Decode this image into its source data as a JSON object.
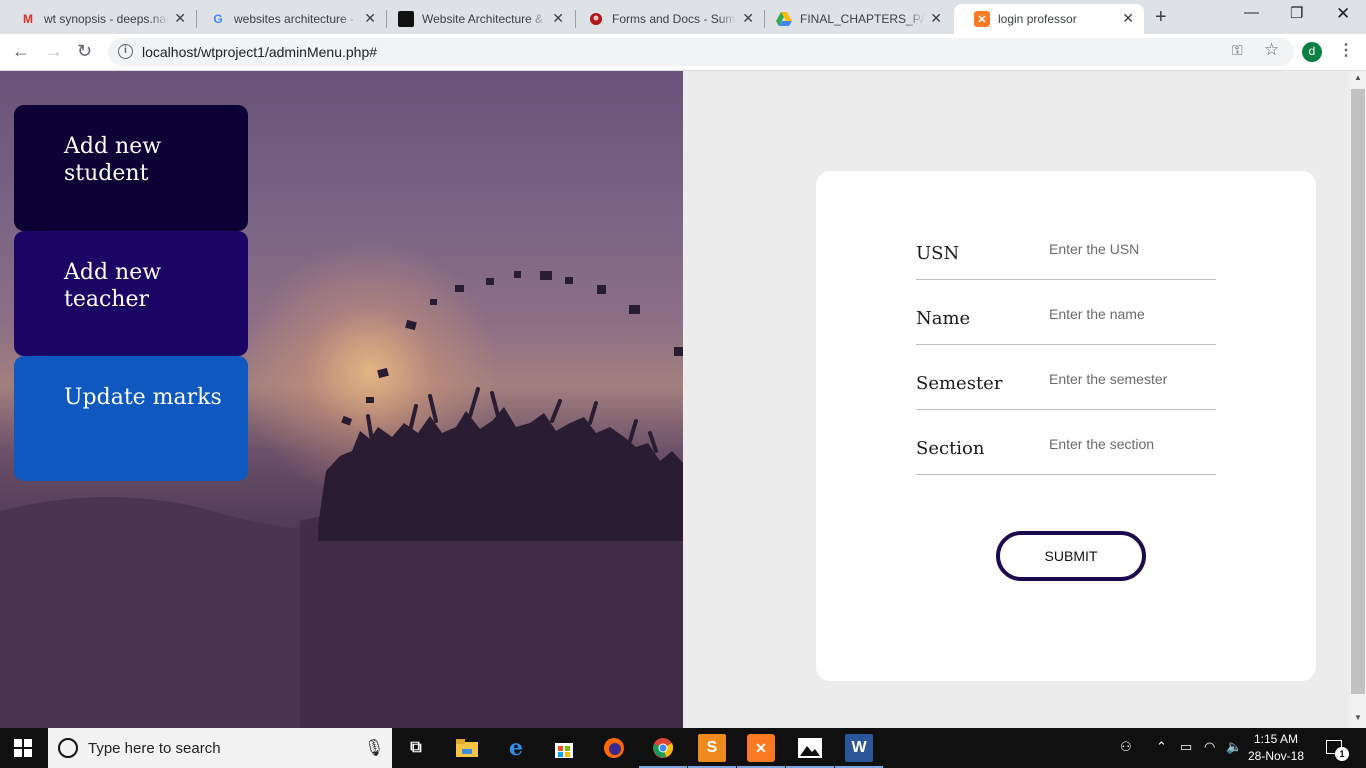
{
  "browser": {
    "tabs": [
      {
        "icon": "gmail-icon",
        "title": "wt synopsis - deeps.nag"
      },
      {
        "icon": "google-icon",
        "title": "websites architecture -"
      },
      {
        "icon": "site-icon",
        "title": "Website Architecture &"
      },
      {
        "icon": "forms-icon",
        "title": "Forms and Docs - Suma"
      },
      {
        "icon": "drive-icon",
        "title": "FINAL_CHAPTERS_PAGE"
      },
      {
        "icon": "xampp-icon",
        "title": "login professor"
      }
    ],
    "url": "localhost/wtproject1/adminMenu.php#",
    "profile_initial": "d"
  },
  "sidebar": {
    "items": [
      {
        "label": "Add new student",
        "color": "#0c0134"
      },
      {
        "label": "Add new teacher",
        "color": "#1a0464"
      },
      {
        "label": "Update marks",
        "color": "#0e58c0"
      }
    ]
  },
  "form": {
    "fields": [
      {
        "label": "USN",
        "placeholder": "Enter the USN"
      },
      {
        "label": "Name",
        "placeholder": "Enter the name"
      },
      {
        "label": "Semester",
        "placeholder": "Enter the semester"
      },
      {
        "label": "Section",
        "placeholder": "Enter the section"
      }
    ],
    "submit_label": "SUBMIT"
  },
  "taskbar": {
    "search_placeholder": "Type here to search",
    "time": "1:15 AM",
    "date": "28-Nov-18",
    "notification_count": "1"
  }
}
